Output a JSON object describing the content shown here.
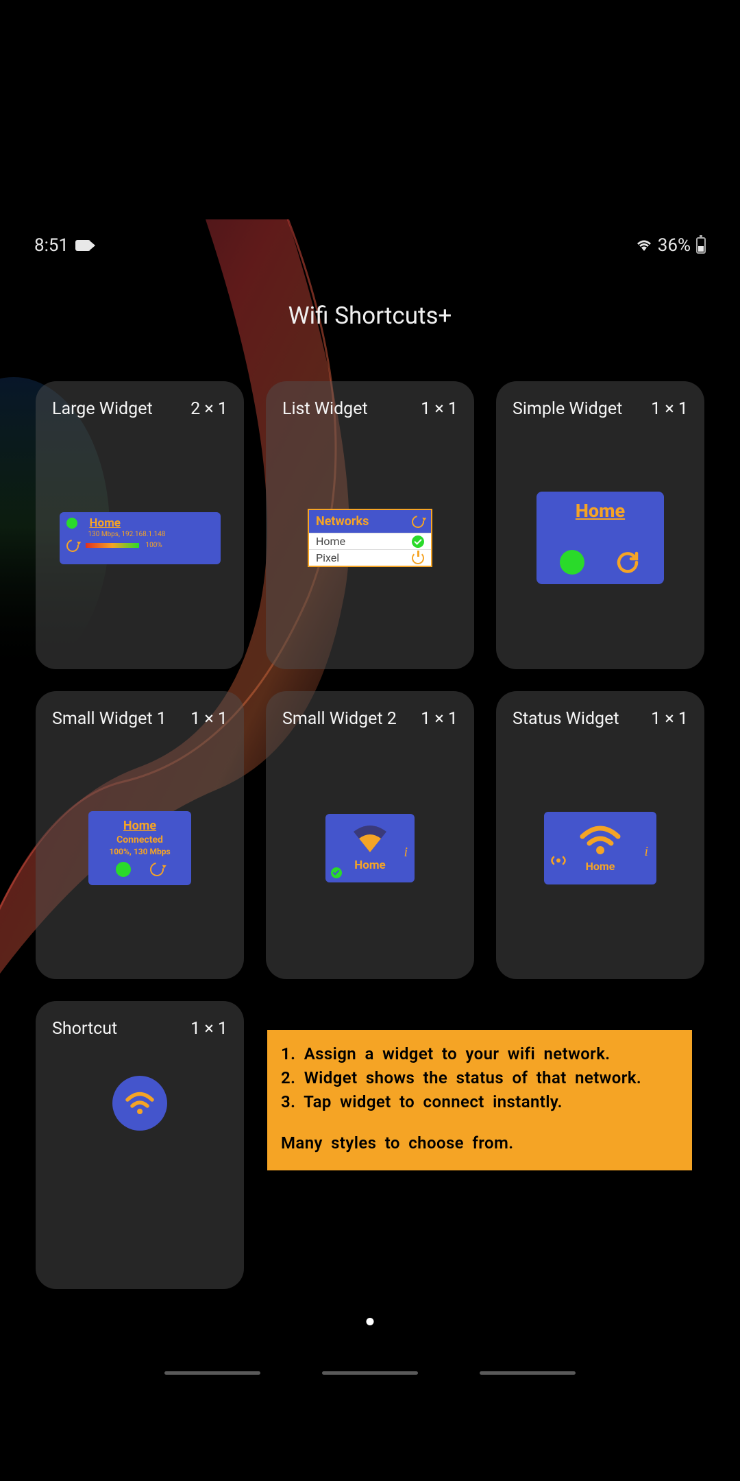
{
  "status_bar": {
    "time": "8:51",
    "battery_percent": "36%"
  },
  "title": "Wifi Shortcuts+",
  "widgets": [
    {
      "name": "Large Widget",
      "size": "2 × 1",
      "sample": {
        "network": "Home",
        "details": "130 Mbps, 192.168.1.148",
        "signal_pct": "100%"
      }
    },
    {
      "name": "List Widget",
      "size": "1 × 1",
      "sample": {
        "header": "Networks",
        "rows": [
          "Home",
          "Pixel"
        ]
      }
    },
    {
      "name": "Simple Widget",
      "size": "1 × 1",
      "sample": {
        "network": "Home"
      }
    },
    {
      "name": "Small Widget 1",
      "size": "1 × 1",
      "sample": {
        "network": "Home",
        "status": "Connected",
        "speed": "100%, 130 Mbps"
      }
    },
    {
      "name": "Small Widget 2",
      "size": "1 × 1",
      "sample": {
        "network": "Home"
      }
    },
    {
      "name": "Status Widget",
      "size": "1 × 1",
      "sample": {
        "network": "Home"
      }
    },
    {
      "name": "Shortcut",
      "size": "1 × 1"
    }
  ],
  "info": {
    "steps": [
      "Assign a widget to your wifi network.",
      "Widget shows the status of that network.",
      "Tap widget to connect instantly."
    ],
    "footer": "Many styles to choose from."
  }
}
